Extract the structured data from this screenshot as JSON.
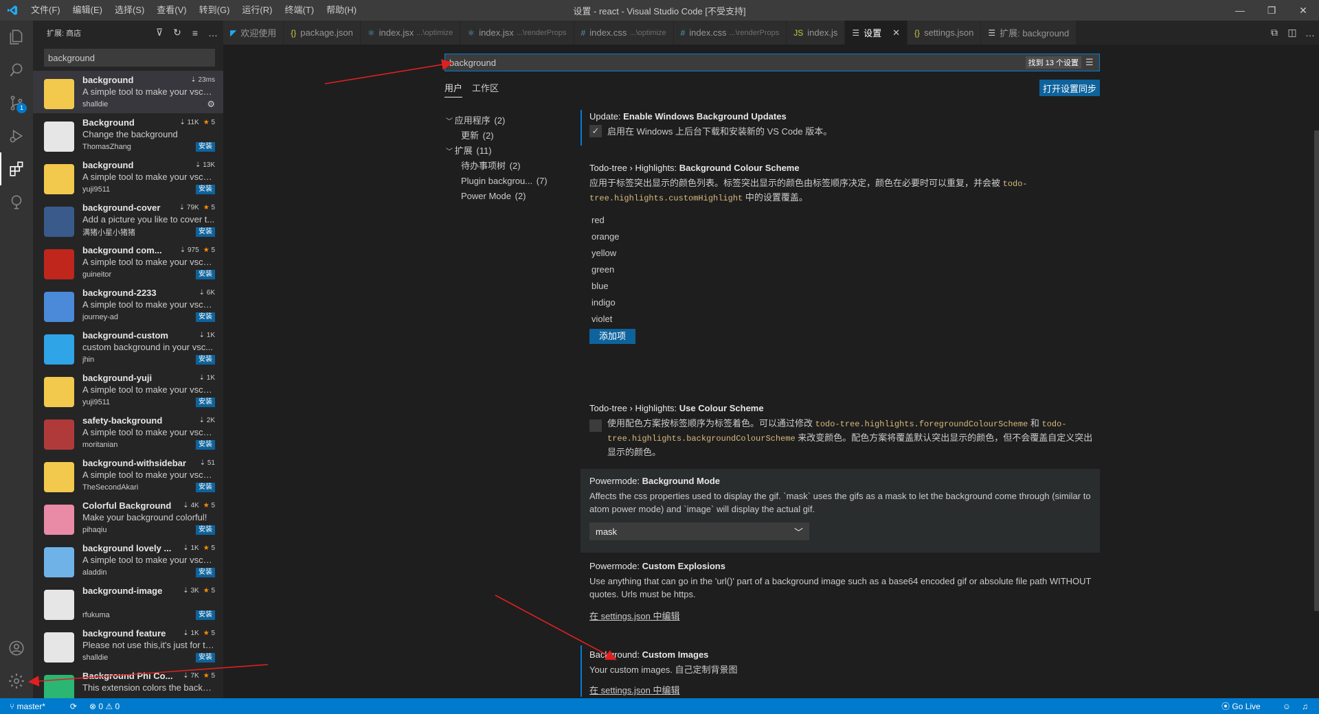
{
  "window": {
    "title": "设置 - react - Visual Studio Code [不受支持]",
    "menus": [
      "文件(F)",
      "编辑(E)",
      "选择(S)",
      "查看(V)",
      "转到(G)",
      "运行(R)",
      "终端(T)",
      "帮助(H)"
    ]
  },
  "activity_bar": {
    "scm_badge": "1"
  },
  "sidebar": {
    "title": "扩展: 商店",
    "search_value": "background",
    "extensions": [
      {
        "name": "background",
        "desc": "A simple tool to make your vsco...",
        "publisher": "shalldie",
        "stat": "23ms",
        "stars": "",
        "installed": true,
        "color": "#f2c94c"
      },
      {
        "name": "Background",
        "desc": "Change the background",
        "publisher": "ThomasZhang",
        "stat": "11K",
        "stars": "5",
        "install": "安装",
        "color": "#e6e6e6"
      },
      {
        "name": "background",
        "desc": "A simple tool to make your vsco...",
        "publisher": "yuji9511",
        "stat": "13K",
        "stars": "",
        "install": "安装",
        "color": "#f2c94c"
      },
      {
        "name": "background-cover",
        "desc": "Add a picture you like to cover t...",
        "publisher": "满猪小星小猪猪",
        "stat": "79K",
        "stars": "5",
        "install": "安装",
        "color": "#3a5a8c"
      },
      {
        "name": "background com...",
        "desc": "A simple tool to make your vsco...",
        "publisher": "guineitor",
        "stat": "975",
        "stars": "5",
        "install": "安装",
        "color": "#c0261c"
      },
      {
        "name": "background-2233",
        "desc": "A simple tool to make your vsco...",
        "publisher": "journey-ad",
        "stat": "6K",
        "stars": "",
        "install": "安装",
        "color": "#4a8ad8"
      },
      {
        "name": "background-custom",
        "desc": "custom background in your vsc...",
        "publisher": "jhin",
        "stat": "1K",
        "stars": "",
        "install": "安装",
        "color": "#2fa4e7"
      },
      {
        "name": "background-yuji",
        "desc": "A simple tool to make your vsco...",
        "publisher": "yuji9511",
        "stat": "1K",
        "stars": "",
        "install": "安装",
        "color": "#f2c94c"
      },
      {
        "name": "safety-background",
        "desc": "A simple tool to make your vsco...",
        "publisher": "moritanian",
        "stat": "2K",
        "stars": "",
        "install": "安装",
        "color": "#b03a3a"
      },
      {
        "name": "background-withsidebar",
        "desc": "A simple tool to make your vsco...",
        "publisher": "TheSecondAkari",
        "stat": "51",
        "stars": "",
        "install": "安装",
        "color": "#f2c94c"
      },
      {
        "name": "Colorful Background",
        "desc": "Make your background colorful!",
        "publisher": "pihaqiu",
        "stat": "4K",
        "stars": "5",
        "install": "安装",
        "color": "#e98aa6"
      },
      {
        "name": "background lovely ...",
        "desc": "A simple tool to make your vsco...",
        "publisher": "aladdin",
        "stat": "1K",
        "stars": "5",
        "install": "安装",
        "color": "#6fb2e8"
      },
      {
        "name": "background-image",
        "desc": "",
        "publisher": "rfukuma",
        "stat": "3K",
        "stars": "5",
        "install": "安装",
        "color": "#e6e6e6"
      },
      {
        "name": "background feature",
        "desc": "Please not use this,it's just for te...",
        "publisher": "shalldie",
        "stat": "1K",
        "stars": "5",
        "install": "安装",
        "color": "#e6e6e6"
      },
      {
        "name": "Background Phi Co...",
        "desc": "This extension colors the backgr...",
        "publisher": "",
        "stat": "7K",
        "stars": "5",
        "install": "",
        "color": "#2bb673"
      }
    ]
  },
  "tabs": [
    {
      "label": "欢迎使用",
      "sub": "",
      "icon": "vscode-icon",
      "active": false
    },
    {
      "label": "package.json",
      "sub": "",
      "icon": "json-icon",
      "active": false
    },
    {
      "label": "index.jsx",
      "sub": "...\\optimize",
      "icon": "react-icon",
      "active": false
    },
    {
      "label": "index.jsx",
      "sub": "...\\renderProps",
      "icon": "react-icon",
      "active": false
    },
    {
      "label": "index.css",
      "sub": "...\\optimize",
      "icon": "css-icon",
      "active": false
    },
    {
      "label": "index.css",
      "sub": "...\\renderProps",
      "icon": "css-icon",
      "active": false
    },
    {
      "label": "index.js",
      "sub": "",
      "icon": "js-icon",
      "active": false
    },
    {
      "label": "设置",
      "sub": "",
      "icon": "settings-icon",
      "active": true
    },
    {
      "label": "settings.json",
      "sub": "",
      "icon": "json-icon",
      "active": false
    },
    {
      "label": "扩展: background",
      "sub": "",
      "icon": "extension-icon",
      "active": false
    }
  ],
  "settings": {
    "search_value": "background",
    "result_count": "找到 13 个设置",
    "tab_user": "用户",
    "tab_workspace": "工作区",
    "sync_button": "打开设置同步",
    "toc": [
      {
        "label": "应用程序",
        "count": "(2)",
        "level": 0,
        "expand": "﹀"
      },
      {
        "label": "更新",
        "count": "(2)",
        "level": 1
      },
      {
        "label": "扩展",
        "count": "(11)",
        "level": 0,
        "expand": "﹀"
      },
      {
        "label": "待办事项树",
        "count": "(2)",
        "level": 1
      },
      {
        "label": "Plugin backgrou...",
        "count": "(7)",
        "level": 1
      },
      {
        "label": "Power Mode",
        "count": "(2)",
        "level": 1
      }
    ],
    "items": {
      "update": {
        "prefix": "Update: ",
        "name": "Enable Windows Background Updates",
        "desc": "启用在 Windows 上后台下载和安装新的 VS Code 版本。"
      },
      "todo_scheme": {
        "prefix": "Todo-tree › Highlights: ",
        "name": "Background Colour Scheme",
        "desc1": "应用于标签突出显示的颜色列表。标签突出显示的颜色由标签顺序决定，颜色在必要时可以重复，并会被 ",
        "code1": "todo-tree.highlights.customHighlight",
        "desc2": " 中的设置覆盖。",
        "list": [
          "red",
          "orange",
          "yellow",
          "green",
          "blue",
          "indigo",
          "violet"
        ],
        "add": "添加项"
      },
      "todo_use": {
        "prefix": "Todo-tree › Highlights: ",
        "name": "Use Colour Scheme",
        "desc1": "使用配色方案按标签顺序为标签着色。可以通过修改 ",
        "code1": "todo-tree.highlights.foregroundColourScheme",
        "desc2": " 和 ",
        "code2": "todo-tree.highlights.backgroundColourScheme",
        "desc3": " 来改变颜色。配色方案将覆盖默认突出显示的颜色，但不会覆盖自定义突出显示的颜色。"
      },
      "power_bg": {
        "prefix": "Powermode: ",
        "name": "Background Mode",
        "desc": "Affects the css properties used to display the gif. `mask` uses the gifs as a mask to let the background come through (similar to atom power mode) and `image` will display the actual gif.",
        "value": "mask"
      },
      "power_exp": {
        "prefix": "Powermode: ",
        "name": "Custom Explosions",
        "desc": "Use anything that can go in the 'url()' part of a background image such as a base64 encoded gif or absolute file path WITHOUT quotes. Urls must be https.",
        "link": "在 settings.json 中编辑"
      },
      "bg_custom": {
        "prefix": "Background: ",
        "name": "Custom Images",
        "desc": "Your custom images. 自己定制背景图",
        "link": "在 settings.json 中编辑"
      }
    }
  },
  "statusbar": {
    "branch": "master*",
    "problems": "⊗ 0 ⚠ 0",
    "golive": "Go Live"
  },
  "colors": {
    "accent": "#007acc",
    "install": "#0e639c",
    "annotation": "#e02020"
  }
}
